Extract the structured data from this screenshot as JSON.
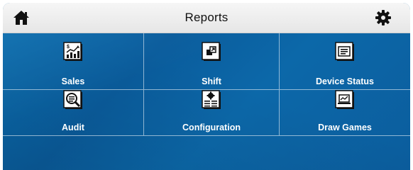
{
  "header": {
    "title": "Reports",
    "home_icon": "home-icon",
    "settings_icon": "gear-icon"
  },
  "tiles": [
    {
      "label": "Sales",
      "icon": "sales-chart-icon"
    },
    {
      "label": "Shift",
      "icon": "shift-icon"
    },
    {
      "label": "Device Status",
      "icon": "device-status-icon"
    },
    {
      "label": "Audit",
      "icon": "audit-magnifier-icon"
    },
    {
      "label": "Configuration",
      "icon": "configuration-gear-document-icon"
    },
    {
      "label": "Draw Games",
      "icon": "draw-games-monitor-icon"
    }
  ],
  "colors": {
    "header_bg": "#eeeeee",
    "panel_bg": "#0a64a6",
    "tile_text": "#ffffff"
  }
}
